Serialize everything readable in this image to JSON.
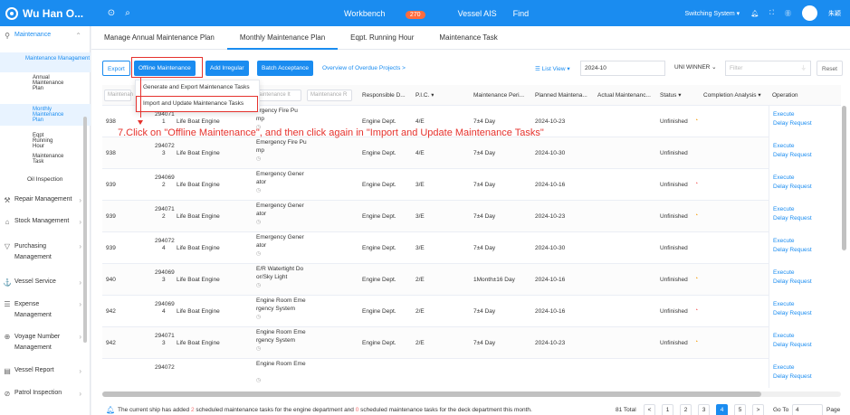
{
  "app": {
    "title": "Wu Han O..."
  },
  "topbar": {
    "workbench": "Workbench",
    "workbench_count": "270",
    "vessel_ais": "Vessel AIS",
    "find": "Find",
    "switching_system": "Switching System ▾",
    "user": "朱颖"
  },
  "sidebar": {
    "maintenance": "Maintenance",
    "maintenance_management": "Maintenance Management",
    "annual": "Annual Maintenance Plan",
    "monthly": "Monthly Maintenance Plan",
    "eqpt": "Eqpt Running Hour",
    "task": "Maintenance Task",
    "oil": "Oil Inspection",
    "repair": "Repair Management",
    "stock": "Stock Management",
    "purchasing": "Purchasing Management",
    "vessel_service": "Vessel Service",
    "expense": "Expense Management",
    "voyage": "Voyage Number Management",
    "vessel_report": "Vessel Report",
    "patrol": "Patrol Inspection"
  },
  "tabs": [
    "Manage Annual Maintenance Plan",
    "Monthly Maintenance Plan",
    "Eqpt. Running Hour",
    "Maintenance Task"
  ],
  "toolbar": {
    "export": "Export",
    "offline": "Offline Maintenance",
    "add_irregular": "Add Irregular",
    "batch": "Batch Acceptance",
    "overview": "Overview of Overdue Projects >",
    "list_view": "List View ▾",
    "month": "2024-10",
    "ship": "UNI WINNER",
    "filter_placeholder": "Filter",
    "reset": "Reset"
  },
  "dropdown": {
    "item1": "Generate and Export Maintenance Tasks",
    "item2": "Import and Update Maintenance Tasks"
  },
  "annotation": "7.Click on \"Offline Maintenance\", and then click again in \"Import and Update Maintenance Tasks\"",
  "headers": {
    "maint_filter": "Maintenan",
    "item_filter": "laintenance It",
    "name_filter": "Maintenance R",
    "responsible": "Responsible D...",
    "pic": "P.I.C. ▾",
    "period": "Maintenance Peri...",
    "planned": "Planned Maintena...",
    "actual": "Actual Maintenanc...",
    "status": "Status ▾",
    "completion": "Completion Analysis ▾",
    "operation": "Operation"
  },
  "rows": [
    {
      "code": "938",
      "id1": "294071",
      "id2": "1",
      "equip": "Life Boat Engine",
      "name1": "ergency Fire Pu",
      "name2": "mp",
      "dept": "Engine Dept.",
      "pic": "4/E",
      "period": "7±4 Day",
      "planned": "2024-10-23",
      "status": "Unfinished",
      "flag": "warn"
    },
    {
      "code": "938",
      "id1": "294072",
      "id2": "3",
      "equip": "Life Boat Engine",
      "name1": "Emergency Fire Pu",
      "name2": "mp",
      "dept": "Engine Dept.",
      "pic": "4/E",
      "period": "7±4 Day",
      "planned": "2024-10-30",
      "status": "Unfinished",
      "flag": ""
    },
    {
      "code": "939",
      "id1": "294069",
      "id2": "2",
      "equip": "Life Boat Engine",
      "name1": "Emergency Gener",
      "name2": "ator",
      "dept": "Engine Dept.",
      "pic": "3/E",
      "period": "7±4 Day",
      "planned": "2024-10-16",
      "status": "Unfinished",
      "flag": "danger"
    },
    {
      "code": "939",
      "id1": "294071",
      "id2": "2",
      "equip": "Life Boat Engine",
      "name1": "Emergency Gener",
      "name2": "ator",
      "dept": "Engine Dept.",
      "pic": "3/E",
      "period": "7±4 Day",
      "planned": "2024-10-23",
      "status": "Unfinished",
      "flag": "warn"
    },
    {
      "code": "939",
      "id1": "294072",
      "id2": "4",
      "equip": "Life Boat Engine",
      "name1": "Emergency Gener",
      "name2": "ator",
      "dept": "Engine Dept.",
      "pic": "3/E",
      "period": "7±4 Day",
      "planned": "2024-10-30",
      "status": "Unfinished",
      "flag": ""
    },
    {
      "code": "940",
      "id1": "294069",
      "id2": "3",
      "equip": "Life Boat Engine",
      "name1": "E/R Watertight Do",
      "name2": "or/Sky Light",
      "dept": "Engine Dept.",
      "pic": "2/E",
      "period": "1Month±16 Day",
      "planned": "2024-10-16",
      "status": "Unfinished",
      "flag": "warn"
    },
    {
      "code": "942",
      "id1": "294069",
      "id2": "4",
      "equip": "Life Boat Engine",
      "name1": "Engine Room Eme",
      "name2": "rgency System",
      "dept": "Engine Dept.",
      "pic": "2/E",
      "period": "7±4 Day",
      "planned": "2024-10-16",
      "status": "Unfinished",
      "flag": "danger"
    },
    {
      "code": "942",
      "id1": "294071",
      "id2": "3",
      "equip": "Life Boat Engine",
      "name1": "Engine Room Eme",
      "name2": "rgency System",
      "dept": "Engine Dept.",
      "pic": "2/E",
      "period": "7±4 Day",
      "planned": "2024-10-23",
      "status": "Unfinished",
      "flag": "warn"
    },
    {
      "code": "",
      "id1": "294072",
      "id2": "",
      "equip": "",
      "name1": "Engine Room Eme",
      "name2": "",
      "dept": "",
      "pic": "",
      "period": "",
      "planned": "",
      "status": "",
      "flag": ""
    }
  ],
  "operations": {
    "execute": "Execute",
    "delay": "Delay Request"
  },
  "footer": {
    "msg_prefix": "The current ship has added ",
    "engine_count": "2",
    "msg_mid": " scheduled maintenance tasks for the engine department and ",
    "deck_count": "0",
    "msg_suffix": " scheduled maintenance tasks for the deck department this month.",
    "total": "81 Total",
    "pages": [
      "1",
      "2",
      "3",
      "4",
      "5"
    ],
    "current_page": "4",
    "goto": "Go To",
    "goto_value": "4",
    "page": "Page"
  },
  "colors": {
    "primary": "#1a8cf0",
    "annotation": "#e5322d",
    "warn": "#f5a623",
    "danger": "#f56c6c"
  }
}
